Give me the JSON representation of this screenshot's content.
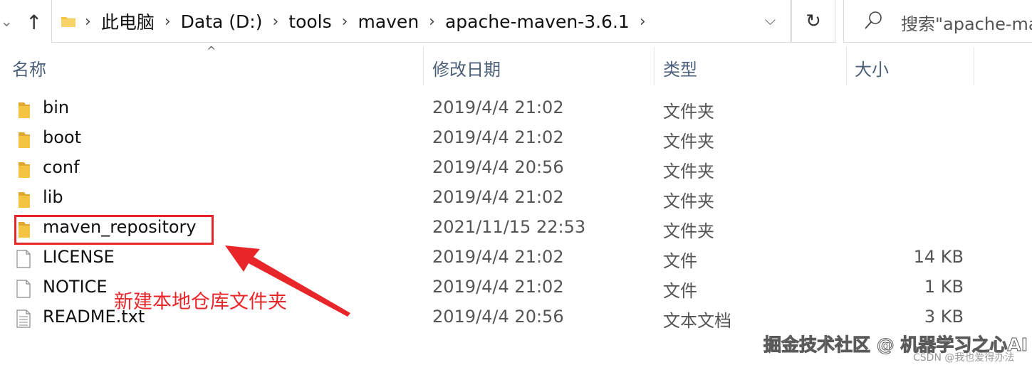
{
  "address_bar": {
    "breadcrumbs": [
      "此电脑",
      "Data (D:)",
      "tools",
      "maven",
      "apache-maven-3.6.1"
    ],
    "search_placeholder": "搜索\"apache-ma"
  },
  "columns": {
    "name": "名称",
    "modified": "修改日期",
    "type": "类型",
    "size": "大小"
  },
  "files": [
    {
      "name": "bin",
      "modified": "2019/4/4 21:02",
      "type": "文件夹",
      "size": "",
      "icon": "folder-icon"
    },
    {
      "name": "boot",
      "modified": "2019/4/4 21:02",
      "type": "文件夹",
      "size": "",
      "icon": "folder-icon"
    },
    {
      "name": "conf",
      "modified": "2019/4/4 20:56",
      "type": "文件夹",
      "size": "",
      "icon": "folder-icon"
    },
    {
      "name": "lib",
      "modified": "2019/4/4 21:02",
      "type": "文件夹",
      "size": "",
      "icon": "folder-icon"
    },
    {
      "name": "maven_repository",
      "modified": "2021/11/15 22:53",
      "type": "文件夹",
      "size": "",
      "icon": "folder-icon"
    },
    {
      "name": "LICENSE",
      "modified": "2019/4/4 21:02",
      "type": "文件",
      "size": "14 KB",
      "icon": "file-icon"
    },
    {
      "name": "NOTICE",
      "modified": "2019/4/4 21:02",
      "type": "文件",
      "size": "1 KB",
      "icon": "file-icon"
    },
    {
      "name": "README.txt",
      "modified": "2019/4/4 20:56",
      "type": "文本文档",
      "size": "3 KB",
      "icon": "text-file-icon"
    }
  ],
  "annotation": {
    "text": "新建本地仓库文件夹",
    "color": "#e8262a"
  },
  "watermark": {
    "main": "掘金技术社区 @ 机器学习之心AI",
    "sub": "CSDN @我也爱得办法"
  },
  "colors": {
    "folder": "#f5c342",
    "header_text": "#4c607a"
  }
}
